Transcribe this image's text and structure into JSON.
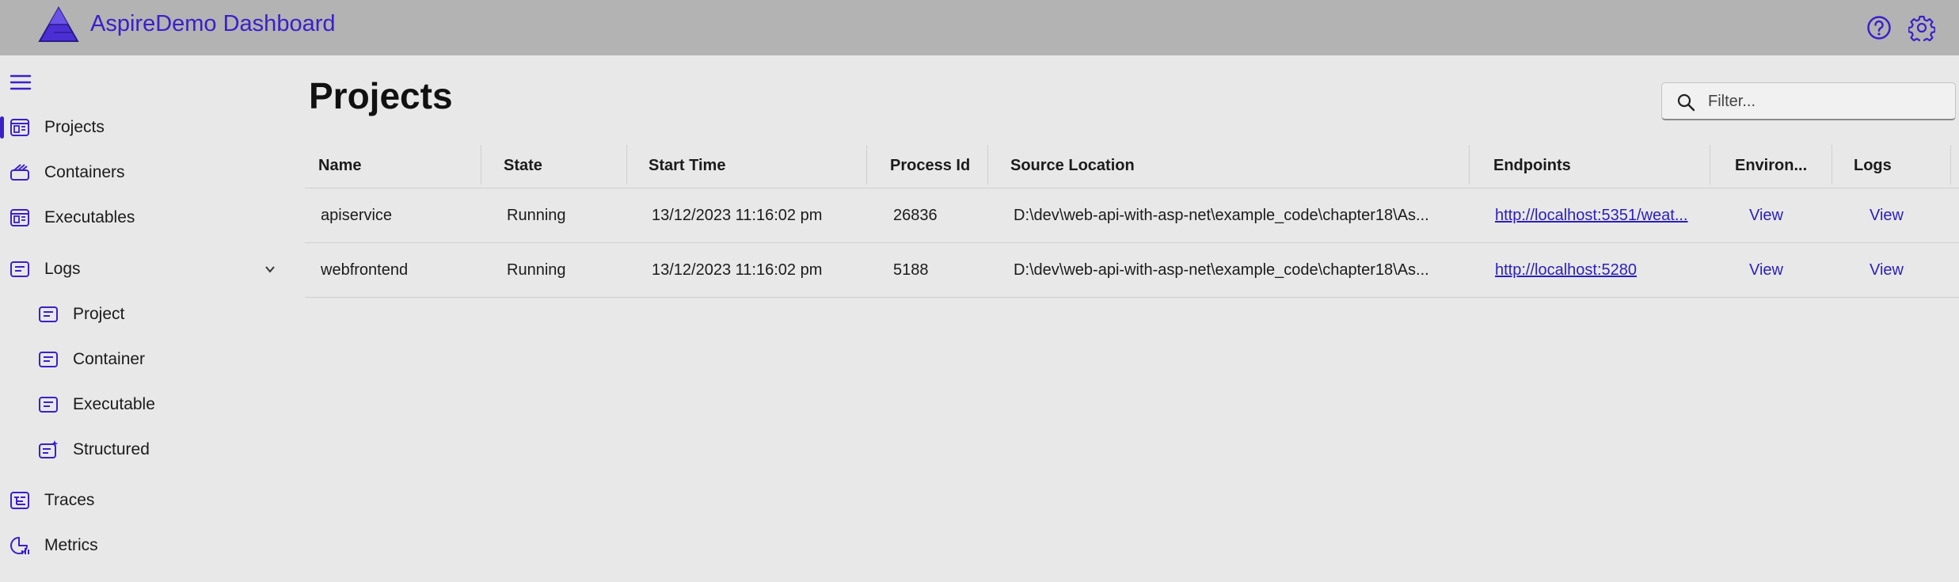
{
  "header": {
    "app_title": "AspireDemo Dashboard",
    "icons": [
      "logo",
      "help-icon",
      "gear-icon"
    ]
  },
  "colors": {
    "accent": "#3b20c9",
    "header_bg": "#b3b3b3",
    "page_bg": "#e8e8e8"
  },
  "sidebar": {
    "items": [
      {
        "label": "Projects",
        "icon": "projects-icon",
        "active": true
      },
      {
        "label": "Containers",
        "icon": "containers-icon"
      },
      {
        "label": "Executables",
        "icon": "executables-icon"
      },
      {
        "label": "Logs",
        "icon": "logs-icon",
        "expanded": true
      },
      {
        "label": "Project",
        "icon": "log-project-icon"
      },
      {
        "label": "Container",
        "icon": "log-container-icon"
      },
      {
        "label": "Executable",
        "icon": "log-executable-icon"
      },
      {
        "label": "Structured",
        "icon": "structured-logs-icon"
      },
      {
        "label": "Traces",
        "icon": "traces-icon"
      },
      {
        "label": "Metrics",
        "icon": "metrics-icon"
      }
    ]
  },
  "main": {
    "title": "Projects",
    "filter_placeholder": "Filter...",
    "columns": [
      "Name",
      "State",
      "Start Time",
      "Process Id",
      "Source Location",
      "Endpoints",
      "Environ...",
      "Logs"
    ],
    "rows": [
      {
        "name": "apiservice",
        "state": "Running",
        "start_time": "13/12/2023 11:16:02 pm",
        "process_id": "26836",
        "source_location": "D:\\dev\\web-api-with-asp-net\\example_code\\chapter18\\As...",
        "endpoint": "http://localhost:5351/weat...",
        "environment": "View",
        "logs": "View"
      },
      {
        "name": "webfrontend",
        "state": "Running",
        "start_time": "13/12/2023 11:16:02 pm",
        "process_id": "5188",
        "source_location": "D:\\dev\\web-api-with-asp-net\\example_code\\chapter18\\As...",
        "endpoint": "http://localhost:5280",
        "environment": "View",
        "logs": "View"
      }
    ]
  }
}
